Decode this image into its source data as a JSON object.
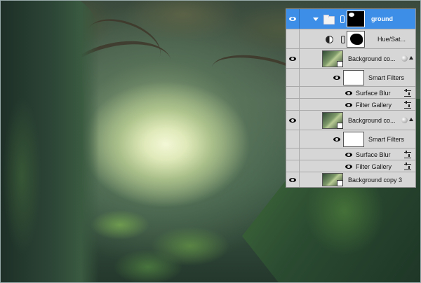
{
  "layers": [
    {
      "name": "ground",
      "type": "group",
      "selected": true,
      "icons": [
        "eye-icon",
        "disclosure-triangle-icon",
        "folder-icon",
        "chain-icon",
        "mask-thumbnail"
      ]
    },
    {
      "name": "Hue/Sat...",
      "type": "adjustment",
      "icons": [
        "adjustment-icon",
        "chain-icon",
        "mask-thumbnail"
      ]
    },
    {
      "name": "Background co...",
      "type": "smart-object",
      "icons": [
        "eye-icon",
        "smart-object-thumbnail",
        "fx-icon",
        "collapse-icon"
      ]
    },
    {
      "name": "Smart Filters",
      "type": "smart-filters",
      "icons": [
        "eye-icon",
        "filter-mask-thumbnail"
      ]
    },
    {
      "name": "Surface Blur",
      "type": "filter",
      "icons": [
        "eye-icon",
        "filter-options-icon"
      ]
    },
    {
      "name": "Filter Gallery",
      "type": "filter",
      "icons": [
        "eye-icon",
        "filter-options-icon"
      ]
    },
    {
      "name": "Background co...",
      "type": "smart-object",
      "icons": [
        "eye-icon",
        "smart-object-thumbnail",
        "fx-icon",
        "collapse-icon"
      ]
    },
    {
      "name": "Smart Filters",
      "type": "smart-filters",
      "icons": [
        "eye-icon",
        "filter-mask-thumbnail"
      ]
    },
    {
      "name": "Surface Blur",
      "type": "filter",
      "icons": [
        "eye-icon",
        "filter-options-icon"
      ]
    },
    {
      "name": "Filter Gallery",
      "type": "filter",
      "icons": [
        "eye-icon",
        "filter-options-icon"
      ]
    },
    {
      "name": "Background copy 3",
      "type": "smart-object",
      "icons": [
        "eye-icon",
        "smart-object-thumbnail"
      ]
    }
  ],
  "colors": {
    "selection": "#3d8ee6",
    "panel": "#d6d6d6"
  }
}
